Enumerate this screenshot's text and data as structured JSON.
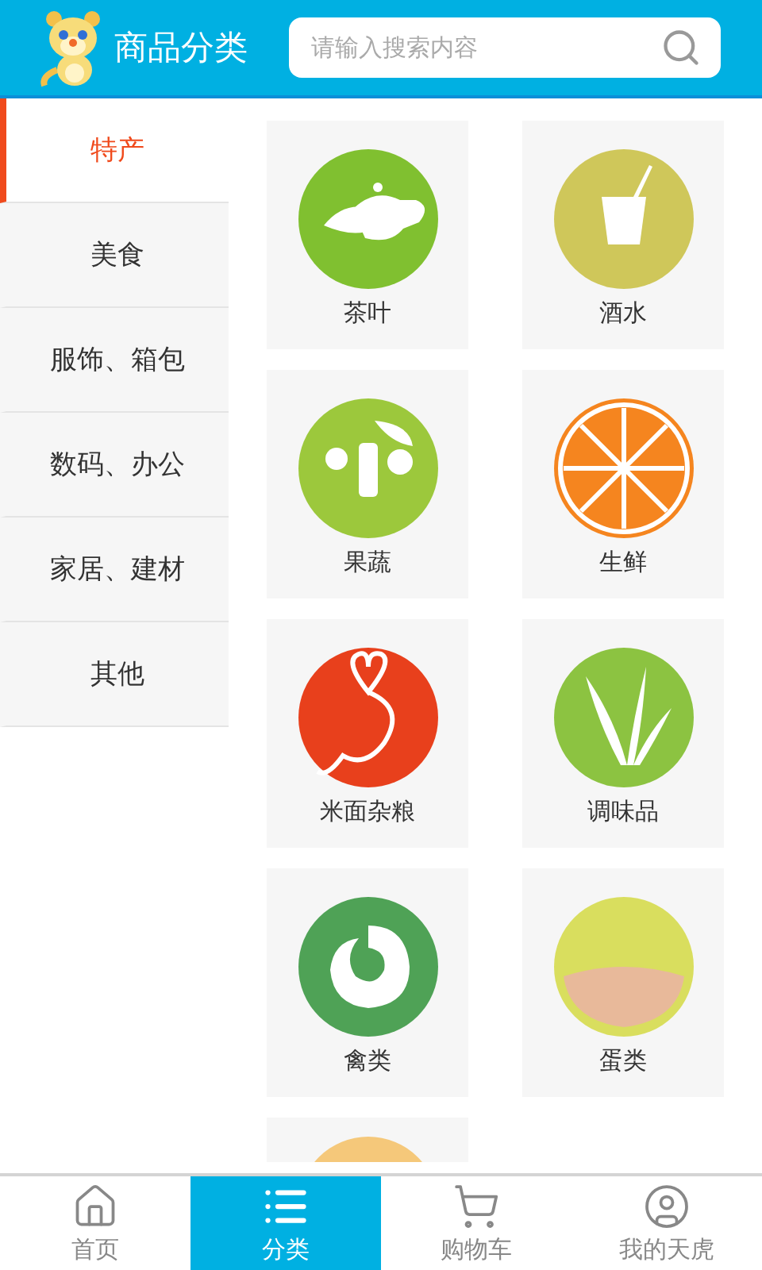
{
  "header": {
    "title": "商品分类",
    "search": {
      "placeholder": "请输入搜索内容"
    }
  },
  "sidebar": {
    "items": [
      {
        "label": "特产",
        "selected": true
      },
      {
        "label": "美食",
        "selected": false
      },
      {
        "label": "服饰、箱包",
        "selected": false
      },
      {
        "label": "数码、办公",
        "selected": false
      },
      {
        "label": "家居、建材",
        "selected": false
      },
      {
        "label": "其他",
        "selected": false
      }
    ]
  },
  "categories": [
    {
      "name": "茶叶",
      "kind": "tea",
      "color": "#80c030"
    },
    {
      "name": "酒水",
      "kind": "drink",
      "color": "#cfc75a"
    },
    {
      "name": "果蔬",
      "kind": "produce",
      "color": "#9cc83c"
    },
    {
      "name": "生鲜",
      "kind": "fresh",
      "color": "#f5851f"
    },
    {
      "name": "米面杂粮",
      "kind": "grain",
      "color": "#e8401c"
    },
    {
      "name": "调味品",
      "kind": "seasoning",
      "color": "#8cc341"
    },
    {
      "name": "禽类",
      "kind": "poultry",
      "color": "#4fa256"
    },
    {
      "name": "蛋类",
      "kind": "egg",
      "color": "#d9de5e"
    },
    {
      "kind": "partial",
      "color": "#f5c87a"
    }
  ],
  "tabbar": [
    {
      "label": "首页",
      "kind": "home",
      "selected": false
    },
    {
      "label": "分类",
      "kind": "list",
      "selected": true
    },
    {
      "label": "购物车",
      "kind": "cart",
      "selected": false
    },
    {
      "label": "我的天虎",
      "kind": "user",
      "selected": false
    }
  ]
}
